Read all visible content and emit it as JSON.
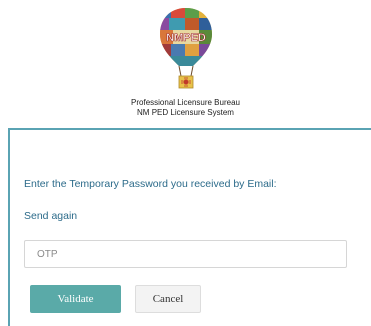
{
  "header": {
    "logo_text": "NMPED",
    "org_line1": "Professional Licensure Bureau",
    "org_line2": "NM PED Licensure System"
  },
  "form": {
    "prompt": "Enter the Temporary Password you received by Email:",
    "send_again_label": "Send again",
    "otp_placeholder": "OTP",
    "otp_value": "",
    "validate_label": "Validate",
    "cancel_label": "Cancel"
  },
  "colors": {
    "accent": "#5aaaa8",
    "border_accent": "#5aa3b3",
    "text_link": "#2c6b8a"
  },
  "icons": {
    "logo": "hot-air-balloon-logo-icon",
    "zia_symbol": "zia-sun-icon"
  }
}
